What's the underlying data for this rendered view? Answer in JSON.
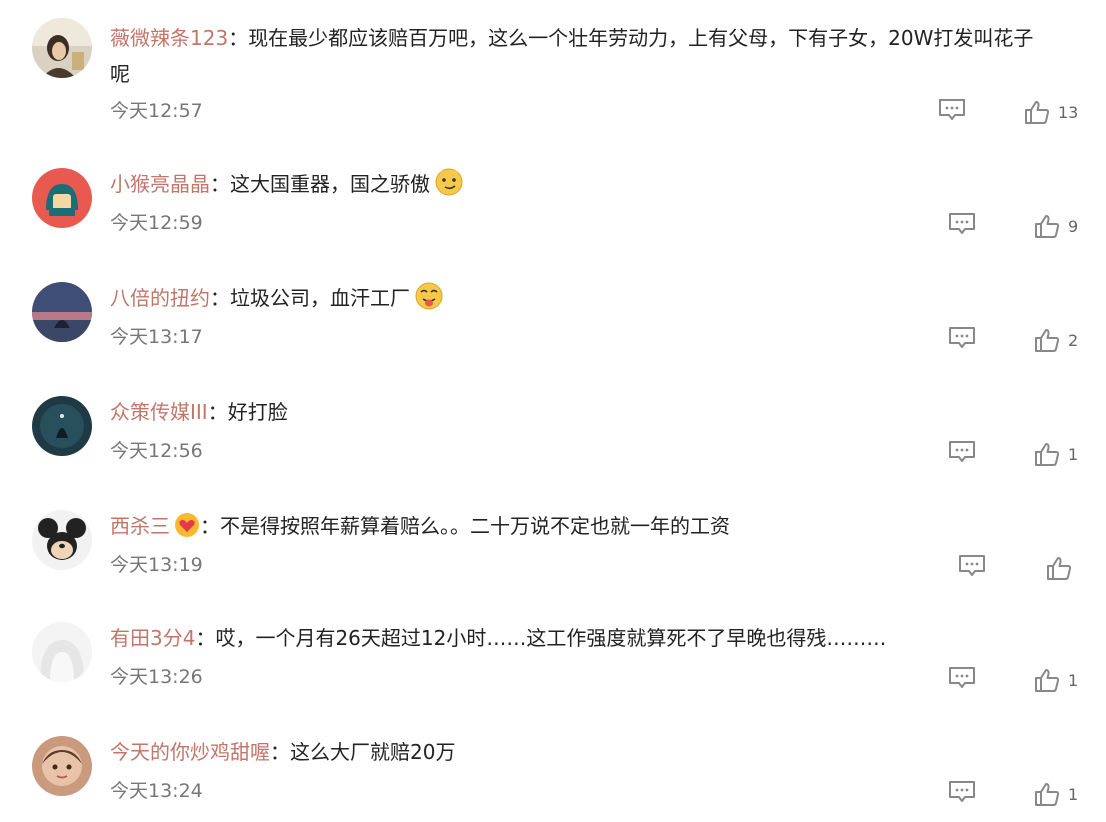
{
  "comments": [
    {
      "username": "薇微辣条123",
      "text": "现在最少都应该赔百万吧，这么一个壮年劳动力，上有父母，下有子女，20W打发叫花子呢",
      "text_line1": "现在最少都应该赔百万吧，这么一个壮年劳动力，上有父母，下有子女，20W打发叫花子",
      "text_line2": "呢",
      "time": "今天12:57",
      "likes": "13"
    },
    {
      "username": "小猴亮晶晶",
      "text": "这大国重器，国之骄傲",
      "emoji": "smirk-face-emoji",
      "time": "今天12:59",
      "likes": "9"
    },
    {
      "username": "八倍的扭约",
      "text": "垃圾公司，血汗工厂",
      "emoji": "tongue-face-emoji",
      "time": "今天13:17",
      "likes": "2"
    },
    {
      "username": "众策传媒III",
      "text": "好打脸",
      "time": "今天12:56",
      "likes": "1"
    },
    {
      "username": "西杀三",
      "badge": "heart-badge-icon",
      "text": "不是得按照年薪算着赔么。。二十万说不定也就一年的工资",
      "time": "今天13:19",
      "likes": ""
    },
    {
      "username": "有田3分4",
      "text": "哎，一个月有26天超过12小时……这工作强度就算死不了早晚也得残………",
      "time": "今天13:26",
      "likes": "1"
    },
    {
      "username": "今天的你炒鸡甜喔",
      "text": "这么大厂就赔20万",
      "time": "今天13:24",
      "likes": "1"
    }
  ],
  "separator": "：",
  "colors": {
    "username": "#c2766a",
    "text": "#222222",
    "meta": "#777777",
    "icon": "#888888"
  }
}
